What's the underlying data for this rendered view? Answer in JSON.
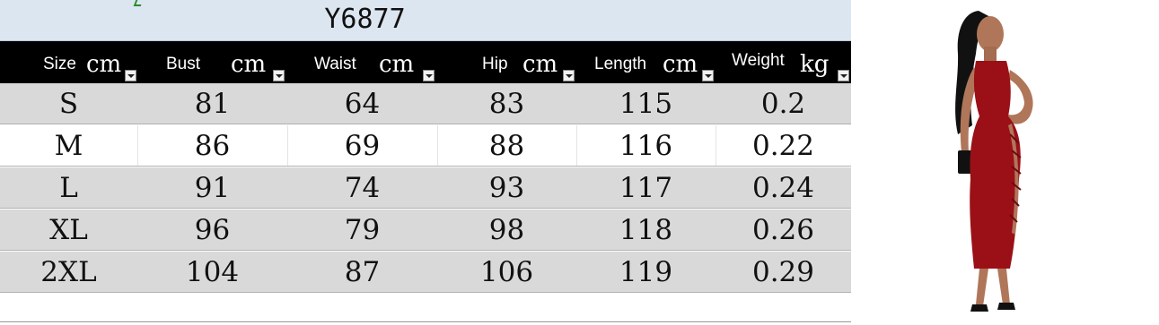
{
  "sheet": {
    "title": "Y6877",
    "headers": [
      {
        "label": "Size",
        "unit": "cm"
      },
      {
        "label": "Bust",
        "unit": "cm"
      },
      {
        "label": "Waist",
        "unit": "cm"
      },
      {
        "label": "Hip",
        "unit": "cm"
      },
      {
        "label": "Length",
        "unit": "cm"
      },
      {
        "label": "Weight",
        "unit": "kg"
      }
    ],
    "rows": [
      [
        "S",
        "81",
        "64",
        "83",
        "115",
        "0.2"
      ],
      [
        "M",
        "86",
        "69",
        "88",
        "116",
        "0.22"
      ],
      [
        "L",
        "91",
        "74",
        "93",
        "117",
        "0.24"
      ],
      [
        "XL",
        "96",
        "79",
        "98",
        "118",
        "0.26"
      ],
      [
        "2XL",
        "104",
        "87",
        "106",
        "119",
        "0.29"
      ]
    ]
  },
  "colors": {
    "header_bg": "#000000",
    "title_bg": "#dce6f1",
    "row_shade": "#d9d9d9",
    "dress": "#9b1017"
  },
  "photo": {
    "subject": "model-in-red-lace-up-midi-dress"
  }
}
